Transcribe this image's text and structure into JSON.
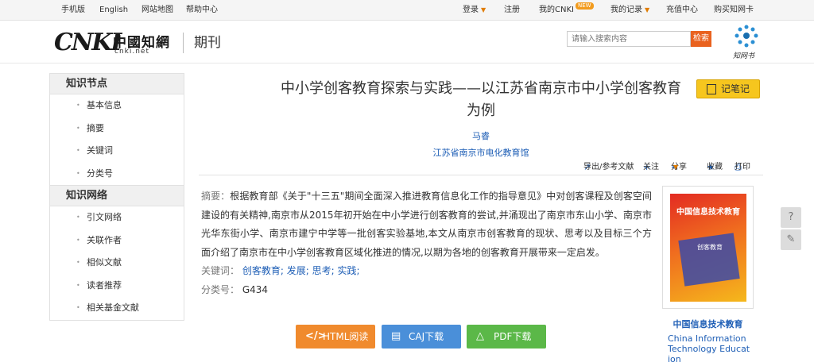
{
  "topbar": {
    "mobile": "手机版",
    "english": "English",
    "sitemap": "网站地图",
    "help": "帮助中心",
    "login": "登录",
    "register": "注册",
    "my_cnki": "我的CNKI",
    "new_badge": "NEW",
    "my_records": "我的记录",
    "recharge": "充值中心",
    "buy_card": "购买知网卡"
  },
  "header": {
    "logo_cnki": "CNKI",
    "logo_cn": "中國知網",
    "logo_url": "cnki.net",
    "section": "期刊",
    "search_placeholder": "请输入搜索内容",
    "search_button": "检索",
    "zwb_label": "知网书"
  },
  "sidebar": {
    "nodes_title": "知识节点",
    "nodes": [
      "基本信息",
      "摘要",
      "关键词",
      "分类号"
    ],
    "network_title": "知识网络",
    "network": [
      "引文网络",
      "关联作者",
      "相似文献",
      "读者推荐",
      "相关基金文献"
    ]
  },
  "article": {
    "title": "中小学创客教育探索与实践——以江苏省南京市中小学创客教育为例",
    "author": "马睿",
    "org": "江苏省南京市电化教育馆",
    "note_button": "记笔记",
    "tools": {
      "export": "导出/参考文献",
      "follow": "关注",
      "share": "分享",
      "collect": "收藏",
      "print": "打印"
    },
    "abstract_label": "摘要：",
    "abstract": "根据教育部《关于\"十三五\"期间全面深入推进教育信息化工作的指导意见》中对创客课程及创客空间建设的有关精神,南京市从2015年初开始在中小学进行创客教育的尝试,并涌现出了南京市东山小学、南京市光华东街小学、南京市建宁中学等一批创客实验基地,本文从南京市创客教育的现状、思考以及目标三个方面介绍了南京市在中小学创客教育区域化推进的情况,以期为各地的创客教育开展带来一定启发。",
    "keywords_label": "关键词：",
    "keywords": [
      "创客教育;",
      "发展;",
      "思考;",
      "实践;"
    ],
    "clc_label": "分类号：",
    "clc": "G434"
  },
  "downloads": {
    "html": "HTML阅读",
    "caj": "CAJ下载",
    "pdf": "PDF下载"
  },
  "journal": {
    "cover_title": "中国信息技术教育",
    "cover_sub": "创客教育",
    "name_cn": "中国信息技术教育",
    "name_en": "China Information Technology Education"
  },
  "colors": {
    "accent_orange": "#e9621f",
    "link_blue": "#1f5fb6",
    "note_yellow": "#f6c61e",
    "html_orange": "#f08a2d",
    "caj_blue": "#4a8fd9",
    "pdf_green": "#5bb848"
  },
  "icons": {
    "export": "export-icon",
    "follow": "plus-icon",
    "share": "share-icon",
    "collect": "star-icon",
    "print": "printer-icon",
    "note": "notebook-icon",
    "html": "code-icon",
    "caj": "book-icon",
    "pdf": "pdf-icon",
    "feedback": "chat-bubble-icon",
    "edit": "pencil-icon"
  }
}
